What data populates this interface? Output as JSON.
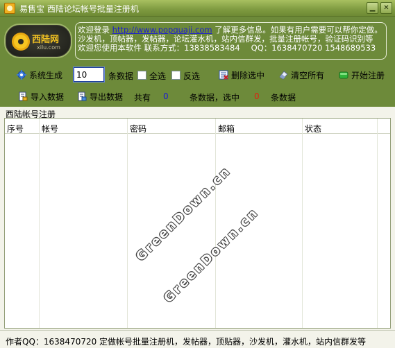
{
  "window": {
    "title": "易售宝 西陆论坛帐号批量注册机",
    "minimize_glyph": "▁",
    "close_glyph": "✕"
  },
  "logo": {
    "text": "西陆网",
    "subtext": "xilu.com"
  },
  "info": {
    "line1_pre": "欢迎登录 ",
    "link": "http://www.popquaji.com",
    "line1_post": " 了解更多信息。如果有用户需要可以帮你定做。",
    "line2": "沙发机，顶帖器，发帖器，论坛灌水机，站内信群发，批量注册帐号，验证码识别等",
    "line3": "欢迎您使用本软件 联系方式：13838583484",
    "qq": "QQ：1638470720 1548689533"
  },
  "toolbar": {
    "generate_label": "系统生成",
    "quantity_value": "10",
    "data_count_label": "条数据",
    "select_all_label": "全选",
    "invert_label": "反选",
    "delete_selected_label": "删除选中",
    "clear_all_label": "清空所有",
    "start_register_label": "开始注册",
    "import_label": "导入数据",
    "export_label": "导出数据",
    "total_label": "共有",
    "total_count": "0",
    "selected_mid_label": "条数据，选中",
    "selected_count": "0",
    "selected_end_label": "条数据"
  },
  "group": {
    "label": "西陆帐号注册"
  },
  "table": {
    "columns": [
      "序号",
      "帐号",
      "密码",
      "邮箱",
      "状态"
    ]
  },
  "watermark": {
    "text1": "GreenDown.cn",
    "text2": "GreenDown.cn"
  },
  "statusbar": {
    "text": "作者QQ：1638470720 定做帐号批量注册机，发帖器，顶贴器，沙发机，灌水机，站内信群发等"
  },
  "colors": {
    "frame": "#6d8a3a",
    "panel": "#f3f3ea",
    "count_total": "#1c1cd0",
    "count_selected": "#e02010"
  },
  "icons": [
    "app-icon",
    "minimize-icon",
    "close-icon",
    "gear-icon",
    "delete-icon",
    "eraser-icon",
    "green-button-icon",
    "import-icon",
    "export-icon"
  ]
}
